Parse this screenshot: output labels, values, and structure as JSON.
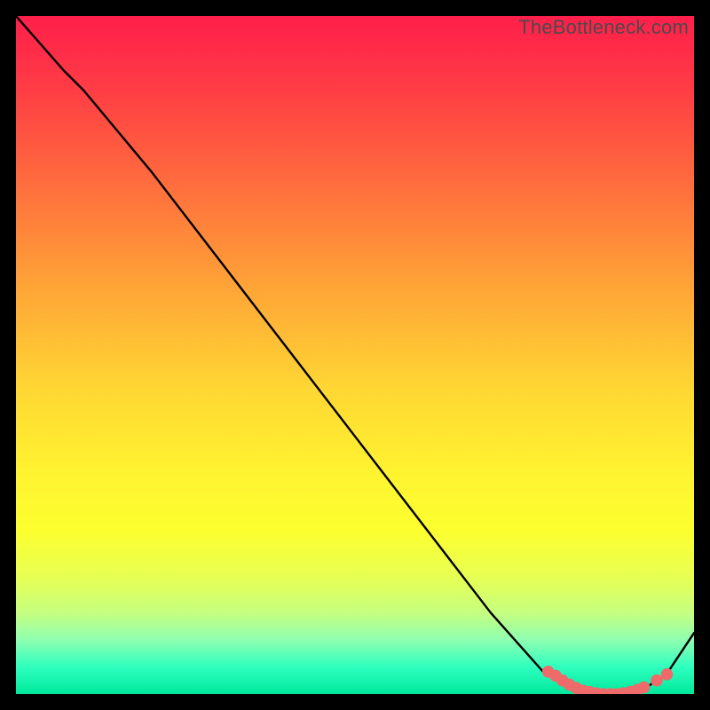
{
  "watermark": "TheBottleneck.com",
  "chart_data": {
    "type": "line",
    "xlim": [
      0,
      100
    ],
    "ylim": [
      0,
      100
    ],
    "title": "",
    "xlabel": "",
    "ylabel": "",
    "series": [
      {
        "name": "curve",
        "x": [
          0,
          7,
          10,
          20,
          30,
          40,
          50,
          60,
          70,
          78,
          82,
          86,
          90,
          93,
          96,
          100
        ],
        "y": [
          100,
          92,
          89,
          77,
          64,
          51,
          38,
          25,
          12,
          3,
          1,
          0,
          0,
          1,
          3,
          9
        ]
      }
    ],
    "markers": {
      "name": "highlight-dots",
      "color": "#ef6a6a",
      "points": [
        {
          "x": 78.5,
          "y": 3.3
        },
        {
          "x": 79.6,
          "y": 2.7
        },
        {
          "x": 80.6,
          "y": 2.0
        },
        {
          "x": 81.6,
          "y": 1.4
        },
        {
          "x": 82.6,
          "y": 0.9
        },
        {
          "x": 83.6,
          "y": 0.5
        },
        {
          "x": 84.6,
          "y": 0.3
        },
        {
          "x": 85.6,
          "y": 0.1
        },
        {
          "x": 86.6,
          "y": 0.0
        },
        {
          "x": 87.6,
          "y": 0.0
        },
        {
          "x": 88.6,
          "y": 0.0
        },
        {
          "x": 89.6,
          "y": 0.1
        },
        {
          "x": 90.6,
          "y": 0.3
        },
        {
          "x": 91.6,
          "y": 0.6
        },
        {
          "x": 92.6,
          "y": 1.0
        },
        {
          "x": 94.5,
          "y": 2.0
        },
        {
          "x": 96.0,
          "y": 2.9
        }
      ]
    }
  }
}
